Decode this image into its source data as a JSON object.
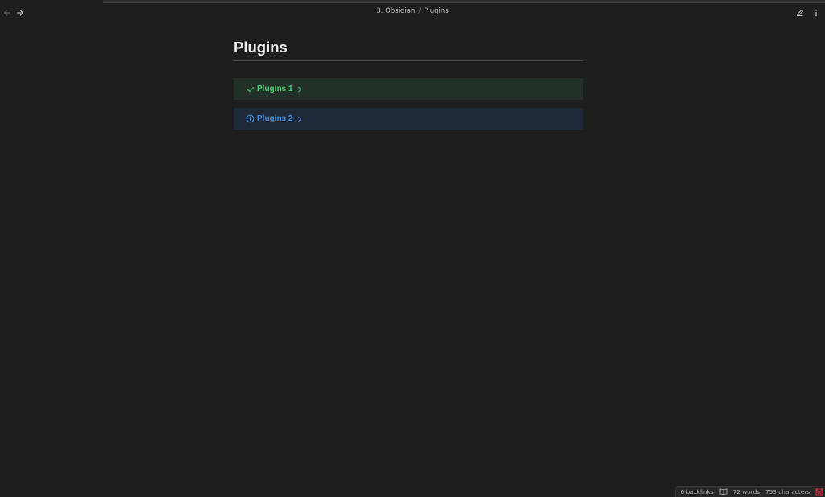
{
  "titlebar": {
    "breadcrumb": [
      "3. Obsidian",
      "Plugins"
    ],
    "separator": "/"
  },
  "page": {
    "title": "Plugins",
    "callouts": [
      {
        "type": "success",
        "icon": "check-icon",
        "title": "Plugins 1"
      },
      {
        "type": "info",
        "icon": "info-icon",
        "title": "Plugins 2"
      }
    ]
  },
  "status": {
    "backlinks": "0 backlinks",
    "words": "72 words",
    "characters": "753 characters"
  },
  "colors": {
    "background": "#1e1e1e",
    "success": "#44cf6e",
    "success_bg": "#23302a",
    "info": "#3f8fe4",
    "info_bg": "#1f2836",
    "sync_error": "#e93147"
  }
}
